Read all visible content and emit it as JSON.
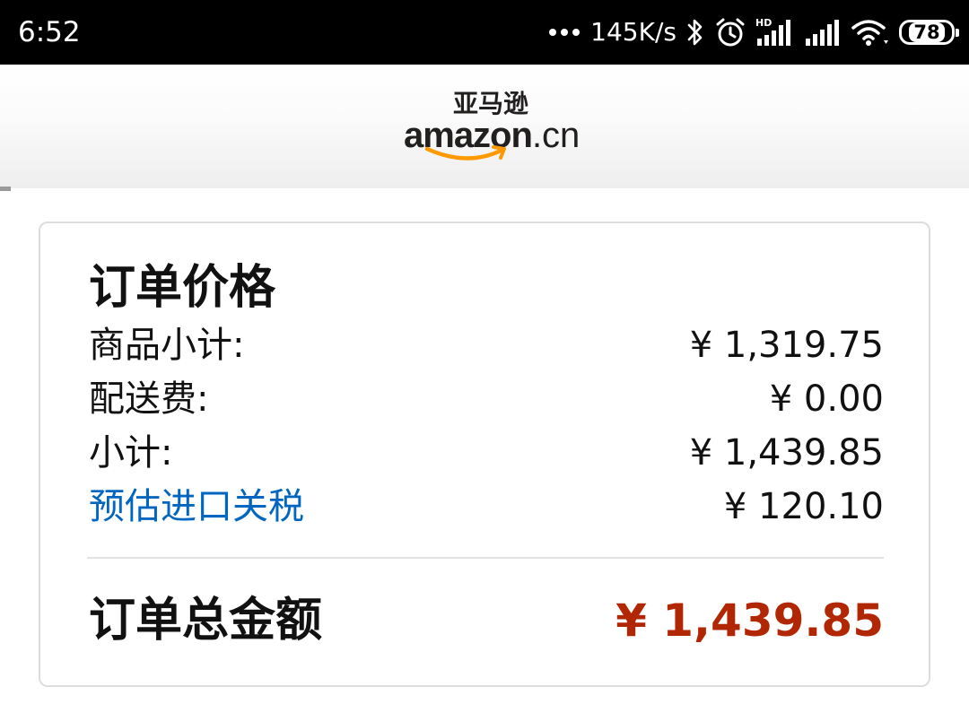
{
  "status_bar": {
    "time": "6:52",
    "net_speed": "145K/s",
    "network_badge": "HD",
    "battery_level": "78",
    "icons": [
      "bluetooth-icon",
      "alarm-icon",
      "signal-hd-icon",
      "signal-icon",
      "wifi-icon",
      "battery-icon"
    ]
  },
  "header": {
    "logo_cn": "亚马逊",
    "logo_word": "amazon",
    "logo_suffix": ".cn",
    "logo_smile_color": "#ff9900"
  },
  "order_summary": {
    "title": "订单价格",
    "rows": [
      {
        "label": "商品小计:",
        "value": "¥ 1,319.75"
      },
      {
        "label": "配送费:",
        "value": "¥ 0.00"
      },
      {
        "label": "小计:",
        "value": "¥ 1,439.85"
      },
      {
        "label": "预估进口关税",
        "value": "¥ 120.10",
        "is_link": true
      }
    ],
    "total_label": "订单总金额",
    "total_value": "¥ 1,439.85"
  },
  "colors": {
    "link": "#0066c0",
    "total_price": "#b12704",
    "status_bar_bg": "#000000"
  }
}
